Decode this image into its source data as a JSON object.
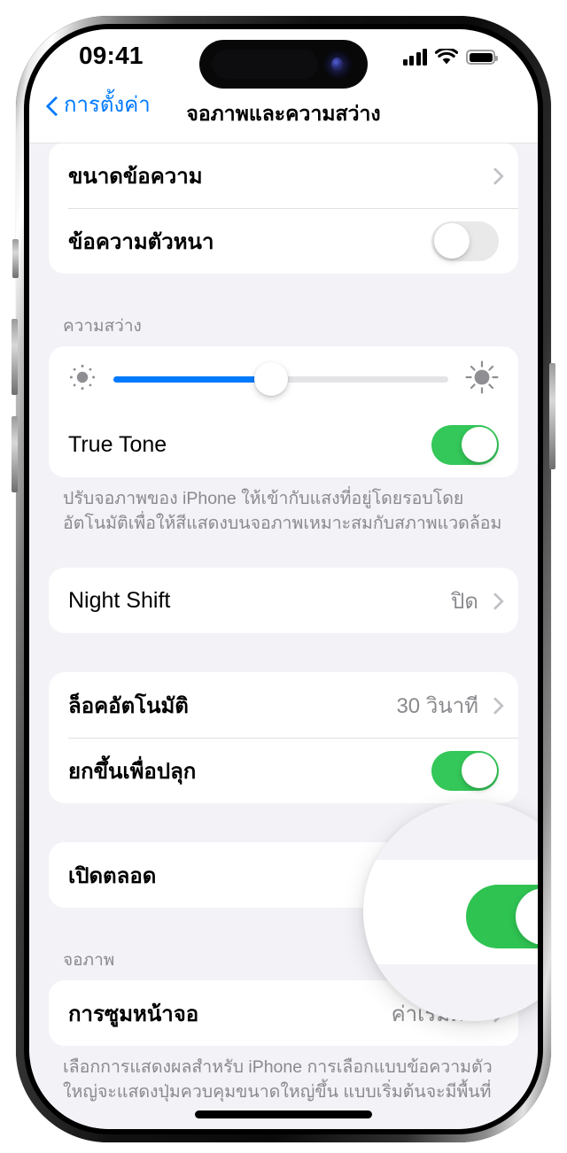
{
  "status_bar": {
    "time": "09:41",
    "signal_icon": "cellular-bars-icon",
    "wifi_icon": "wifi-icon",
    "battery_icon": "battery-full-icon"
  },
  "nav": {
    "back_label": "การตั้งค่า",
    "back_icon": "chevron-left-icon",
    "title": "จอภาพและความสว่าง"
  },
  "sections": {
    "text_group": {
      "text_size": {
        "label": "ขนาดข้อความ",
        "accessory": "chevron-right-icon"
      },
      "bold_text": {
        "label": "ข้อความตัวหนา",
        "toggle": "off"
      }
    },
    "brightness": {
      "header": "ความสว่าง",
      "slider": {
        "value_percent": 47,
        "low_icon": "sun-small-icon",
        "high_icon": "sun-large-icon"
      },
      "true_tone": {
        "label": "True Tone",
        "toggle": "on"
      },
      "footer": "ปรับจอภาพของ iPhone ให้เข้ากับแสงที่อยู่โดยรอบโดยอัตโนมัติเพื่อให้สีแสดงบนจอภาพเหมาะสมกับสภาพแวดล้อม"
    },
    "night_shift": {
      "label": "Night Shift",
      "value": "ปิด",
      "accessory": "chevron-right-icon"
    },
    "lock_group": {
      "auto_lock": {
        "label": "ล็อคอัตโนมัติ",
        "value": "30 วินาที",
        "accessory": "chevron-right-icon"
      },
      "raise_to_wake": {
        "label": "ยกขึ้นเพื่อปลุก",
        "toggle": "on"
      }
    },
    "always_on": {
      "label": "เปิดตลอด",
      "toggle": "on"
    },
    "display": {
      "header": "จอภาพ",
      "display_zoom": {
        "label": "การซูมหน้าจอ",
        "value": "ค่าเริ่มต้น",
        "accessory": "chevron-right-icon"
      },
      "footer": "เลือกการแสดงผลสำหรับ iPhone การเลือกแบบข้อความตัวใหญ่จะแสดงปุ่มควบคุมขนาดใหญ่ขึ้น แบบเริ่มต้นจะมีพื้นที่"
    }
  },
  "callout": {
    "magnified_control": "เปิดตลอด",
    "toggle": "on"
  },
  "colors": {
    "accent_blue": "#007AFF",
    "toggle_green": "#34C759",
    "background": "#F2F2F7",
    "card": "#FFFFFF",
    "secondary_text": "#8A8A8E"
  }
}
